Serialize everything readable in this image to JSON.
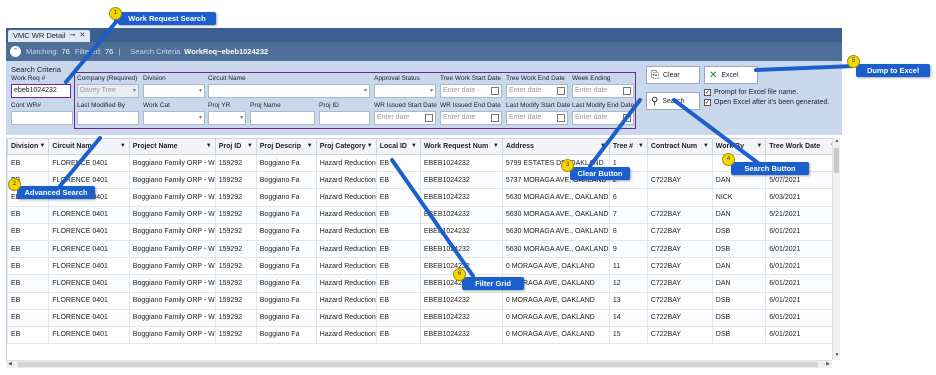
{
  "tab": {
    "title": "VMC WR Detail",
    "pin": "⊸",
    "close": "✕"
  },
  "matchbar": {
    "matching_label": "Matching:",
    "matching_value": "76",
    "filtered_label": "Filtered:",
    "filtered_value": "76",
    "separator": "|",
    "criteria_label": "Search Criteria",
    "criteria_value": "WorkReq~ebeb1024232"
  },
  "criteria": {
    "title": "Search Criteria",
    "row1": {
      "work_req_label": "Work Req #",
      "work_req_value": "ebeb1024232",
      "company_label": "Company (Required)",
      "company_value": "Davey Tree",
      "division_label": "Division",
      "circuit_label": "Circuit Name",
      "approval_label": "Approval Status",
      "tw_start_label": "Tree Work Start Date",
      "tw_end_label": "Tree Work End Date",
      "week_ending_label": "Week Ending",
      "date_placeholder": "Enter date"
    },
    "row2": {
      "cont_wr_label": "Cont WR#",
      "last_modified_label": "Last Modified By",
      "work_cat_label": "Work Cat",
      "proj_yr_label": "Proj YR",
      "proj_name_label": "Proj Name",
      "proj_id_label": "Proj ID",
      "wr_issued_start_label": "WR Issued Start Date",
      "wr_issued_end_label": "WR Issued End Date",
      "last_modify_start_label": "Last Modify Start Date",
      "last_modify_end_label": "Last Modify End Date",
      "date_placeholder": "Enter date"
    }
  },
  "actions": {
    "clear_label": "Clear",
    "excel_label": "Excel",
    "search_label": "Search",
    "prompt_excel": "Prompt for Excel file name.",
    "open_excel": "Open Excel after it's been generated."
  },
  "grid": {
    "columns": [
      "Division",
      "Circuit Name",
      "Project Name",
      "Proj ID",
      "Proj Descrip",
      "Proj Category",
      "Local ID",
      "Work Request Num",
      "Address",
      "Tree #",
      "Contract Num",
      "Work By",
      "Tree Work Date"
    ],
    "rows": [
      [
        "EB",
        "FLORENCE 0401",
        "Boggiano Family ORP - W",
        "159292",
        "Boggiano Fa",
        "Hazard Reduction",
        "EB",
        "EBEB1024232",
        "5799 ESTATES DR, OAKLAND",
        "1",
        "",
        "",
        ""
      ],
      [
        "EB",
        "FLORENCE 0401",
        "Boggiano Family ORP - W",
        "159292",
        "Boggiano Fa",
        "Hazard Reduction",
        "EB",
        "EBEB1024232",
        "5737 MORAGA AVE, OAKLAND",
        "2",
        "C722BAY",
        "DAN",
        "5/07/2021"
      ],
      [
        "EB",
        "FLORENCE 0401",
        "Boggiano Family ORP - W",
        "159292",
        "Boggiano Fa",
        "Hazard Reduction",
        "EB",
        "EBEB1024232",
        "5630 MORAGA AVE., OAKLAND",
        "6",
        "",
        "NICK",
        "6/03/2021"
      ],
      [
        "EB",
        "FLORENCE 0401",
        "Boggiano Family ORP - W",
        "159292",
        "Boggiano Fa",
        "Hazard Reduction",
        "EB",
        "EBEB1024232",
        "5630 MORAGA AVE., OAKLAND",
        "7",
        "C722BAY",
        "DAN",
        "5/21/2021"
      ],
      [
        "EB",
        "FLORENCE 0401",
        "Boggiano Family ORP - W",
        "159292",
        "Boggiano Fa",
        "Hazard Reduction",
        "EB",
        "EBEB1024232",
        "5630 MORAGA AVE., OAKLAND",
        "8",
        "C722BAY",
        "DSB",
        "6/01/2021"
      ],
      [
        "EB",
        "FLORENCE 0401",
        "Boggiano Family ORP - W",
        "159292",
        "Boggiano Fa",
        "Hazard Reduction",
        "EB",
        "EBEB1024232",
        "5630 MORAGA AVE., OAKLAND",
        "9",
        "C722BAY",
        "DSB",
        "6/01/2021"
      ],
      [
        "EB",
        "FLORENCE 0401",
        "Boggiano Family ORP - W",
        "159292",
        "Boggiano Fa",
        "Hazard Reduction",
        "EB",
        "EBEB1024232",
        "0 MORAGA AVE, OAKLAND",
        "11",
        "C722BAY",
        "DAN",
        "6/01/2021"
      ],
      [
        "EB",
        "FLORENCE 0401",
        "Boggiano Family ORP - W",
        "159292",
        "Boggiano Fa",
        "Hazard Reduction",
        "EB",
        "EBEB1024232",
        "0 MORAGA AVE, OAKLAND",
        "12",
        "C722BAY",
        "DAN",
        "6/01/2021"
      ],
      [
        "EB",
        "FLORENCE 0401",
        "Boggiano Family ORP - W",
        "159292",
        "Boggiano Fa",
        "Hazard Reduction",
        "EB",
        "EBEB1024232",
        "0 MORAGA AVE, OAKLAND",
        "13",
        "C722BAY",
        "DSB",
        "6/01/2021"
      ],
      [
        "EB",
        "FLORENCE 0401",
        "Boggiano Family ORP - W",
        "159292",
        "Boggiano Fa",
        "Hazard Reduction",
        "EB",
        "EBEB1024232",
        "0 MORAGA AVE, OAKLAND",
        "14",
        "C722BAY",
        "DSB",
        "6/01/2021"
      ],
      [
        "EB",
        "FLORENCE 0401",
        "Boggiano Family ORP - W",
        "159292",
        "Boggiano Fa",
        "Hazard Reduction",
        "EB",
        "EBEB1024232",
        "0 MORAGA AVE, OAKLAND",
        "15",
        "C722BAY",
        "DSB",
        "6/01/2021"
      ]
    ]
  },
  "callouts": [
    {
      "num": "1",
      "label": "Work Request Search"
    },
    {
      "num": "2",
      "label": "Advanced Search"
    },
    {
      "num": "3",
      "label": "Clear Button"
    },
    {
      "num": "4",
      "label": "Search Button"
    },
    {
      "num": "5",
      "label": "Dump to Excel"
    },
    {
      "num": "6",
      "label": "Filter Grid"
    }
  ],
  "colors": {
    "header": "#3b5f8f",
    "criteria_bg": "#c9d8ea",
    "callout": "#1a5fcc",
    "dot": "#f5d800",
    "highlight_border": "#6b2a8a"
  }
}
